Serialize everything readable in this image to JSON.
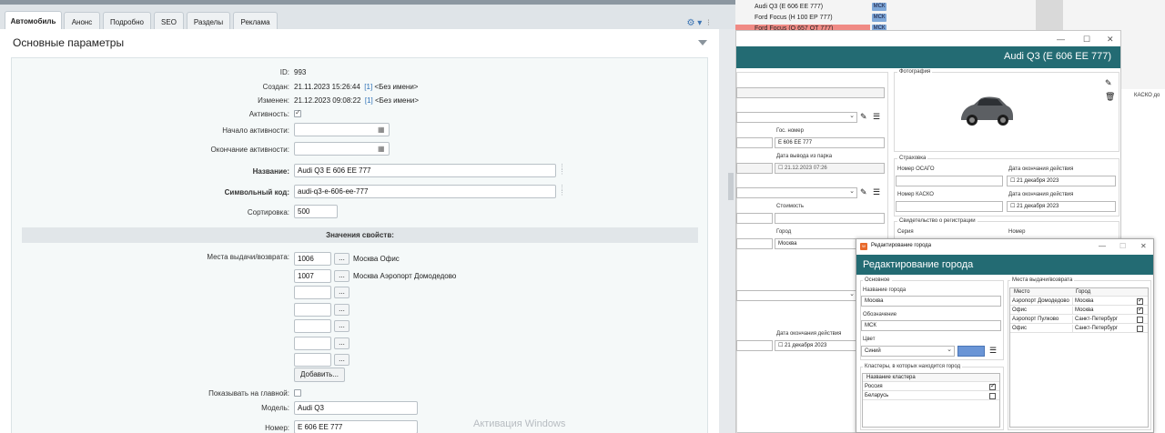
{
  "admin": {
    "tabs": [
      "Автомобиль",
      "Анонс",
      "Подробно",
      "SEO",
      "Разделы",
      "Реклама"
    ],
    "section_title": "Основные параметры",
    "fields": {
      "id_label": "ID:",
      "id_value": "993",
      "created_label": "Создан:",
      "created_value": "21.11.2023 15:26:44",
      "created_link": "[1]",
      "created_user": "<Без имени>",
      "modified_label": "Изменен:",
      "modified_value": "21.12.2023 09:08:22",
      "modified_link": "[1]",
      "modified_user": "<Без имени>",
      "active_label": "Активность:",
      "start_label": "Начало активности:",
      "end_label": "Окончание активности:",
      "name_label": "Название:",
      "name_value": "Audi Q3 E 606 EE 777",
      "code_label": "Символьный код:",
      "code_value": "audi-q3-e-606-ee-777",
      "sort_label": "Сортировка:",
      "sort_value": "500"
    },
    "props_header": "Значения свойств:",
    "places_label": "Места выдачи/возврата:",
    "places": [
      {
        "id": "1006",
        "name": "Москва Офис"
      },
      {
        "id": "1007",
        "name": "Москва Аэропорт Домодедово"
      },
      {
        "id": "",
        "name": ""
      },
      {
        "id": "",
        "name": ""
      },
      {
        "id": "",
        "name": ""
      },
      {
        "id": "",
        "name": ""
      },
      {
        "id": "",
        "name": ""
      }
    ],
    "dots": "...",
    "add_button": "Добавить...",
    "show_main_label": "Показывать на главной:",
    "model_label": "Модель:",
    "model_value": "Audi Q3",
    "number_label": "Номер:",
    "number_value": "E 606 EE 777",
    "watermark": "Активация Windows"
  },
  "desktop": {
    "grid_rows": [
      {
        "name": "Audi Q3 (E 606 EE 777)",
        "city": "МСК",
        "highlight": false
      },
      {
        "name": "Ford Focus (Н 100 ЕР 777)",
        "city": "МСК",
        "highlight": false
      },
      {
        "name": "Ford Focus (О 657 ОТ 777)",
        "city": "МСК",
        "highlight": true
      }
    ],
    "kasko_col": "КАСКО до",
    "car_window": {
      "title": "Audi Q3 (E 606 EE 777)",
      "photo_label": "Фотография",
      "gos_label": "Гос. номер",
      "gos_value": "E 606 EE 777",
      "park_out_label": "Дата вывода из парка",
      "park_out_value": "21.12.2023 07:26",
      "cost_label": "Стоимость",
      "city_label": "Город",
      "city_value": "Москва",
      "insurance_label": "Страховка",
      "osago_label": "Номер ОСАГО",
      "osago_end_label": "Дата окончания действия",
      "osago_end_value": "21  декабря  2023",
      "kasko_label": "Номер КАСКО",
      "kasko_end_label": "Дата окончания действия",
      "kasko_end_value": "21  декабря  2023",
      "reg_label": "Свидетельство о регистрации",
      "series_label": "Серия",
      "number_label": "Номер",
      "end2_label": "Дата окончания действия",
      "end2_value": "21  декабря  2023"
    },
    "city_window": {
      "titlebar": "Редактирование города",
      "header": "Редактирование города",
      "basic_label": "Основное",
      "name_label": "Название города",
      "name_value": "Москва",
      "code_label": "Обозначение",
      "code_value": "МСК",
      "color_label": "Цвет",
      "color_value": "Синий",
      "swatch_color": "#6a95d6",
      "clusters_label": "Кластеры, в которых находится город",
      "cluster_col": "Название кластера",
      "clusters": [
        {
          "name": "Россия",
          "checked": true
        },
        {
          "name": "Беларусь",
          "checked": false
        }
      ],
      "places_label": "Места выдачи/возврата",
      "place_col": "Место",
      "city_col": "Город",
      "places": [
        {
          "place": "Аэропорт Домодедово",
          "city": "Москва",
          "checked": true
        },
        {
          "place": "Офис",
          "city": "Москва",
          "checked": true
        },
        {
          "place": "Аэропорт Пулково",
          "city": "Санкт-Петербург",
          "checked": false
        },
        {
          "place": "Офис",
          "city": "Санкт-Петербург",
          "checked": false
        }
      ]
    }
  }
}
